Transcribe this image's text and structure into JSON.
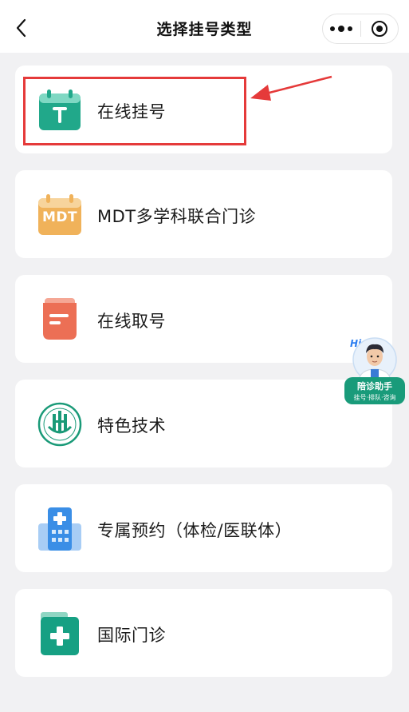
{
  "header": {
    "title": "选择挂号类型"
  },
  "cards": [
    {
      "label": "在线挂号",
      "icon": "calendar-t-icon",
      "icon_text": "T",
      "color": "#21a88a"
    },
    {
      "label": "MDT多学科联合门诊",
      "icon": "calendar-mdt-icon",
      "icon_text": "MDT",
      "color": "#f0b25a"
    },
    {
      "label": "在线取号",
      "icon": "ticket-icon",
      "color": "#ec6f55"
    },
    {
      "label": "特色技术",
      "icon": "hospital-logo-icon",
      "color": "#1a9a78"
    },
    {
      "label": "专属预约（体检/医联体）",
      "icon": "building-cross-icon",
      "color": "#3a8ee6"
    },
    {
      "label": "国际门诊",
      "icon": "medical-kit-icon",
      "color": "#16a083"
    }
  ],
  "assistant": {
    "greeting": "Hi",
    "name": "陪诊助手",
    "subtitle": "挂号·排队·咨询"
  },
  "colors": {
    "highlight": "#e53a3a",
    "background": "#f1f1f3"
  }
}
